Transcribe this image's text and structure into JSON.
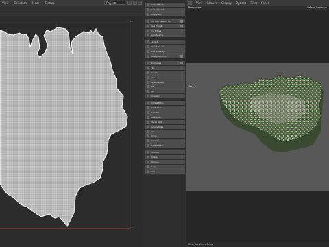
{
  "uv_editor": {
    "menu": [
      "View",
      "Selection",
      "Mesh",
      "Texture"
    ],
    "project_label": "Project",
    "axis": {
      "v_top": "1.0",
      "u_right": "1.0"
    }
  },
  "outliner": {
    "rows": [
      "Unfold Mesh",
      "Relax/Unfold",
      "Straighten",
      "Cut and Sew UV Set",
      "Sew Edges",
      "Cut Edges",
      "Auto Seams",
      "Layout",
      "Orient Shells",
      "Grid and Align",
      "Straighten UVs",
      "Normalize",
      "Flip",
      "Rotate",
      "Scale",
      "Texel Density",
      "Get",
      "Set",
      "Snapshot",
      "UV Set Editor",
      "UV Toolkit",
      "Transfer",
      "Distribute",
      "Match Grid",
      "Symmetrize",
      "Pin",
      "Unpin",
      "Isolate",
      "Shell Border",
      "Checker",
      "Display",
      "Options",
      "Help",
      "Close"
    ],
    "checked_rows": [
      3,
      4,
      10,
      11
    ]
  },
  "viewport": {
    "menu": [
      "View",
      "Camera",
      "Display",
      "Options",
      "Filter",
      "Panel"
    ],
    "camera_left": "Perspective",
    "camera_right": "Default Camera ▽",
    "move_label": "Move ▽",
    "footer": "View Transform: Scene"
  },
  "colors": {
    "uv_wire": "#d9d9d9",
    "uv_outline": "#e8e8e8",
    "terrain_green": "#3f5a34",
    "terrain_gray": "#9a9a9a",
    "border_red": "#b0473b"
  }
}
